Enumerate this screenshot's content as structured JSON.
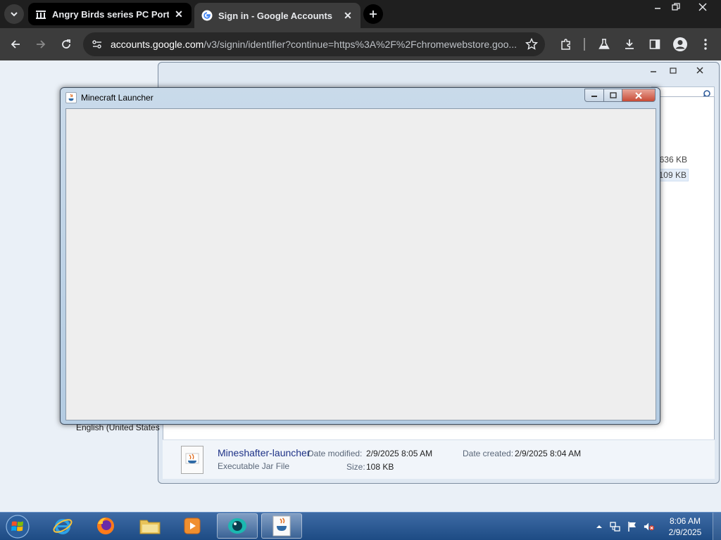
{
  "browser": {
    "tabs": [
      {
        "title": "Angry Birds series PC Ports : R",
        "active": false
      },
      {
        "title": "Sign in - Google Accounts",
        "active": true
      }
    ],
    "url_host": "accounts.google.com",
    "url_path": "/v3/signin/identifier?continue=https%3A%2F%2Fchromewebstore.goo..."
  },
  "explorer": {
    "sizes": [
      "636 KB",
      "109 KB"
    ],
    "language_text": "English (United States",
    "details": {
      "file_name": "Mineshafter-launcher",
      "file_type": "Executable Jar File",
      "date_modified_label": "Date modified:",
      "date_modified_value": "2/9/2025 8:05 AM",
      "date_created_label": "Date created:",
      "date_created_value": "2/9/2025 8:04 AM",
      "size_label": "Size:",
      "size_value": "108 KB"
    }
  },
  "launcher": {
    "title": "Minecraft Launcher"
  },
  "taskbar": {
    "items": [
      "internet-explorer",
      "firefox",
      "windows-explorer",
      "media-player",
      "kakao-app",
      "java"
    ],
    "time": "8:06 AM",
    "date": "2/9/2025"
  },
  "colors": {
    "chrome_dark": "#1f1f1f",
    "chrome_toolbar": "#3c3c3c",
    "taskbar_blue": "#1d4b84",
    "close_red": "#c74b36"
  }
}
